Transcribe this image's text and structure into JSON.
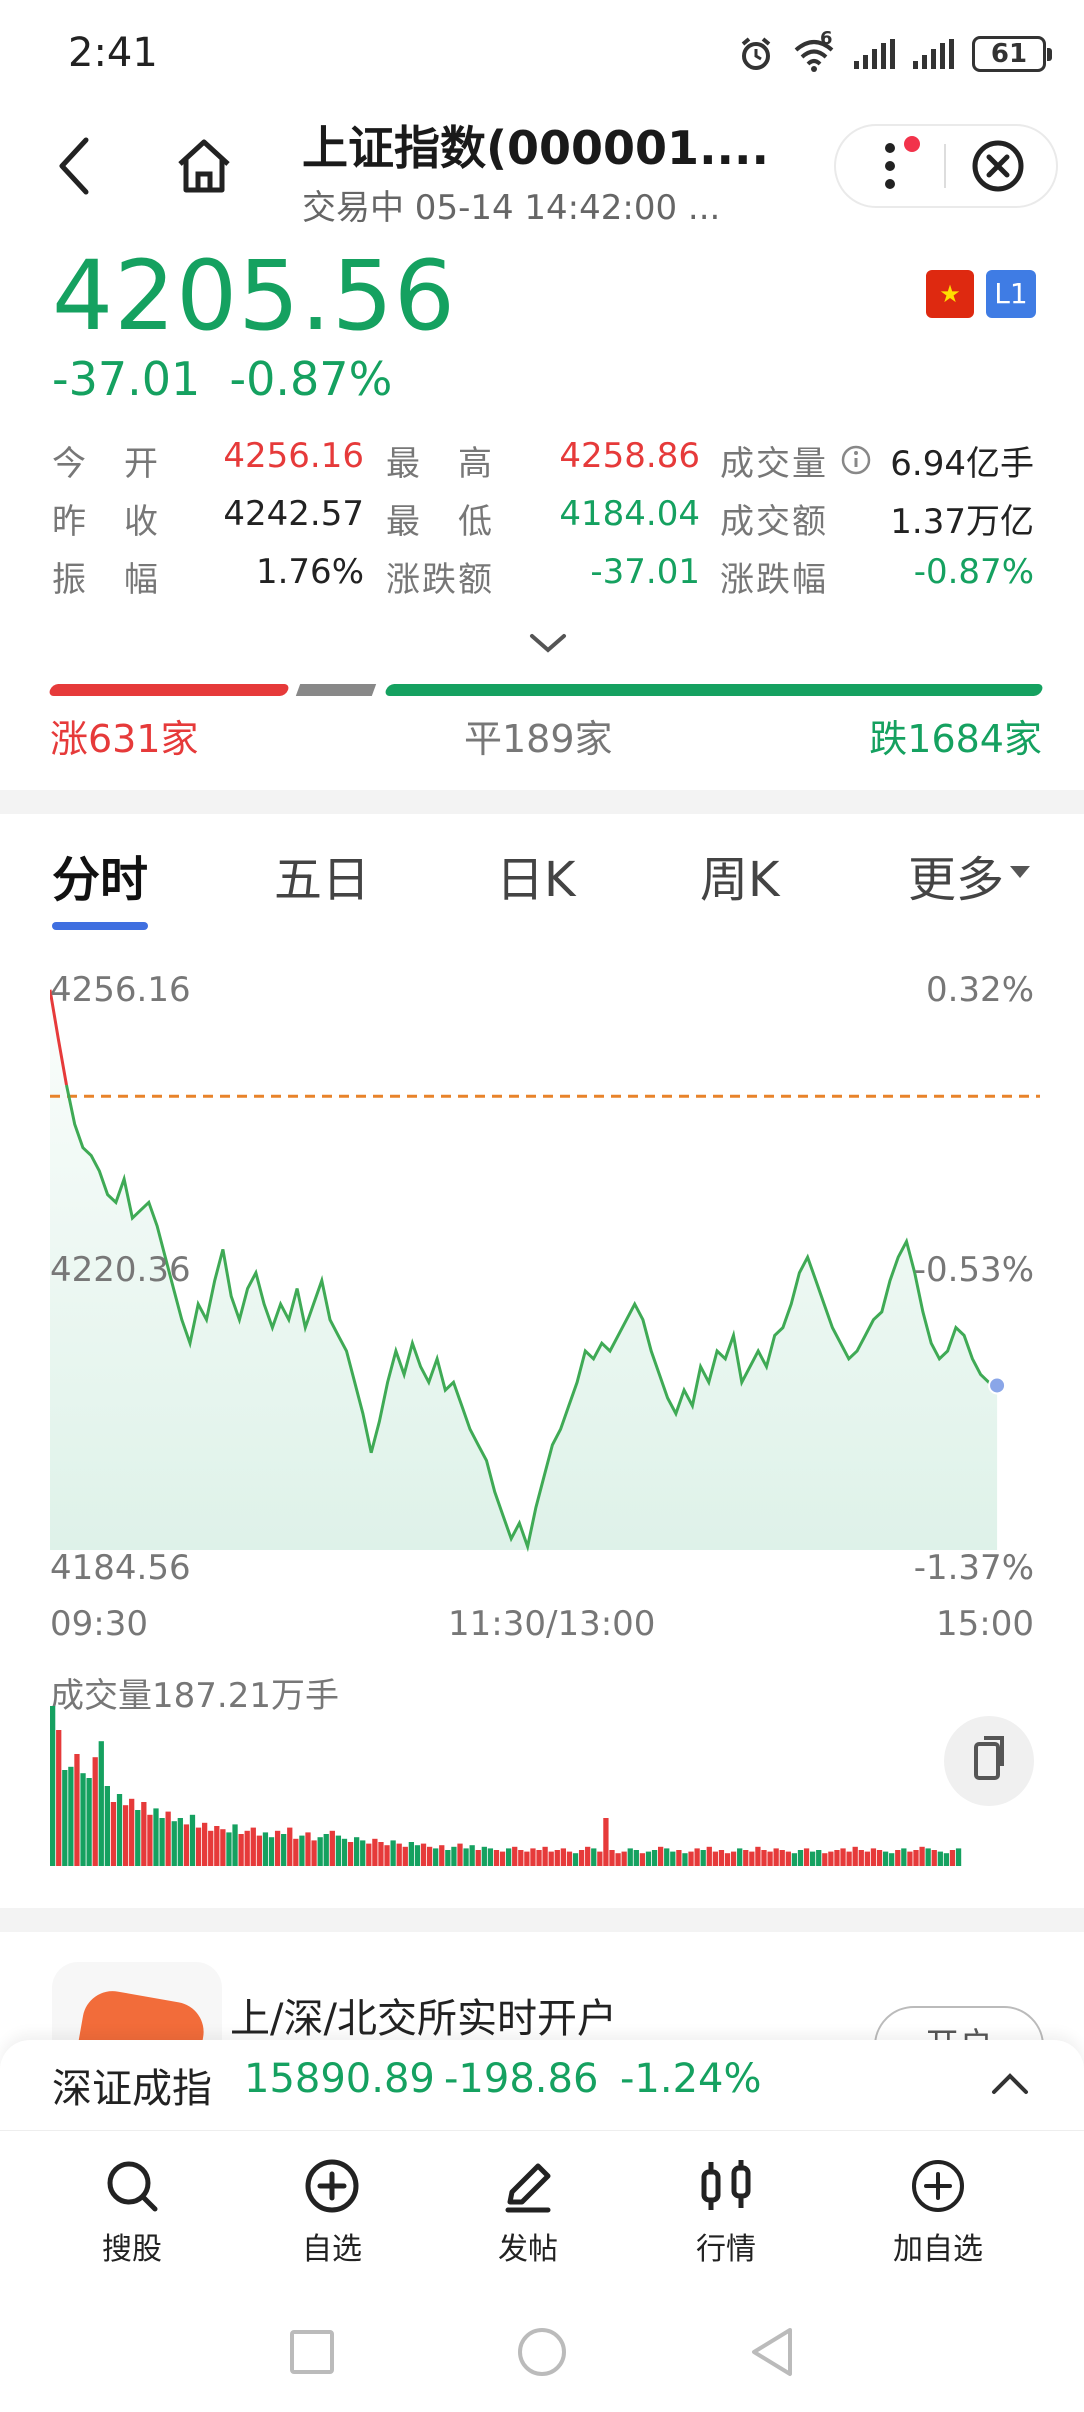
{
  "status_bar": {
    "time": "2:41",
    "battery": "61",
    "wifi_label": "6"
  },
  "header": {
    "title": "上证指数(000001....",
    "subtitle": "交易中 05-14 14:42:00 ..."
  },
  "quote": {
    "price": "4205.56",
    "change": "-37.01",
    "change_pct": "-0.87%",
    "level_badge": "L1",
    "flag_icon": "china-flag-icon"
  },
  "stats": [
    [
      {
        "label": "今　开",
        "value": "4256.16",
        "color": "#e63a3a"
      },
      {
        "label": "最　高",
        "value": "4258.86",
        "color": "#e63a3a"
      },
      {
        "label": "成交量",
        "value": "6.94亿手",
        "color": "#222222"
      }
    ],
    [
      {
        "label": "昨　收",
        "value": "4242.57",
        "color": "#222222"
      },
      {
        "label": "最　低",
        "value": "4184.04",
        "color": "#15a160"
      },
      {
        "label": "成交额",
        "value": "1.37万亿",
        "color": "#222222"
      }
    ],
    [
      {
        "label": "振　幅",
        "value": "1.76%",
        "color": "#222222"
      },
      {
        "label": "涨跌额",
        "value": "-37.01",
        "color": "#15a160"
      },
      {
        "label": "涨跌幅",
        "value": "-0.87%",
        "color": "#15a160"
      }
    ]
  ],
  "breadth": {
    "up": "涨631家",
    "flat": "平189家",
    "down": "跌1684家",
    "up_count": 631,
    "flat_count": 189,
    "down_count": 1684
  },
  "tabs": [
    "分时",
    "五日",
    "日K",
    "周K",
    "更多"
  ],
  "chart": {
    "y_top": "4256.16",
    "y_mid": "4220.36",
    "y_bottom": "4184.56",
    "pct_top": "0.32%",
    "pct_mid": "-0.53%",
    "pct_bottom": "-1.37%",
    "x_start": "09:30",
    "x_mid": "11:30/13:00",
    "x_end": "15:00",
    "volume_label": "成交量187.21万手"
  },
  "chart_data": {
    "type": "line",
    "prev_close": 4242.57,
    "ylim": [
      4184.56,
      4256.16
    ],
    "series": [
      {
        "values": [
          4256.2,
          4250,
          4244,
          4239,
          4236,
          4235,
          4233,
          4230,
          4229,
          4232,
          4227,
          4228,
          4229,
          4226,
          4222,
          4218,
          4214,
          4211,
          4216,
          4214,
          4219,
          4223,
          4217,
          4214,
          4218,
          4220,
          4216,
          4213,
          4216,
          4214,
          4218,
          4213,
          4216,
          4219,
          4214,
          4212,
          4210,
          4206,
          4202,
          4197,
          4201,
          4206,
          4210,
          4207,
          4211,
          4208,
          4206,
          4209,
          4205,
          4206,
          4203,
          4200,
          4198,
          4196,
          4192,
          4189,
          4186,
          4188,
          4185,
          4190,
          4194,
          4198,
          4200,
          4203,
          4206,
          4210,
          4209,
          4211,
          4210,
          4212,
          4214,
          4216,
          4214,
          4210,
          4207,
          4204,
          4202,
          4205,
          4203,
          4208,
          4206,
          4210,
          4209,
          4212,
          4206,
          4208,
          4210,
          4208,
          4212,
          4213,
          4216,
          4220,
          4222,
          4219,
          4216,
          4213,
          4211,
          4209,
          4210,
          4212,
          4214,
          4215,
          4219,
          4222,
          4224,
          4220,
          4215,
          4211,
          4209,
          4210,
          4213,
          4212,
          4209,
          4207,
          4206,
          4205.6
        ]
      }
    ]
  },
  "volume_data": {
    "values": [
      100,
      85,
      60,
      62,
      70,
      58,
      55,
      68,
      78,
      50,
      40,
      45,
      38,
      42,
      35,
      40,
      32,
      36,
      30,
      34,
      28,
      30,
      26,
      32,
      24,
      27,
      22,
      25,
      23,
      21,
      26,
      20,
      22,
      24,
      19,
      21,
      18,
      22,
      20,
      24,
      17,
      19,
      21,
      16,
      18,
      20,
      22,
      19,
      17,
      15,
      18,
      16,
      14,
      17,
      15,
      13,
      16,
      14,
      12,
      15,
      13,
      14,
      12,
      11,
      13,
      10,
      12,
      14,
      11,
      13,
      10,
      12,
      11,
      10,
      9,
      11,
      12,
      10,
      9,
      11,
      10,
      12,
      9,
      10,
      11,
      9,
      8,
      10,
      12,
      11,
      9,
      30,
      10,
      8,
      9,
      11,
      10,
      8,
      9,
      10,
      12,
      11,
      9,
      10,
      8,
      9,
      11,
      10,
      12,
      9,
      10,
      8,
      9,
      11,
      10,
      9,
      12,
      10,
      9,
      11,
      10,
      9,
      8,
      10,
      11,
      9,
      10,
      8,
      9,
      10,
      11,
      9,
      12,
      10,
      9,
      11,
      10,
      9,
      8,
      10,
      11,
      9,
      10,
      12,
      11,
      10,
      9,
      8,
      10,
      11
    ]
  },
  "promo": {
    "text": "上/深/北交所实时开户",
    "button": "开户"
  },
  "ticker": {
    "name": "深证成指",
    "price": "15890.89",
    "change": "-198.86",
    "pct": "-1.24%"
  },
  "nav": [
    {
      "label": "搜股",
      "icon": "search-icon"
    },
    {
      "label": "自选",
      "icon": "add-circle-icon"
    },
    {
      "label": "发帖",
      "icon": "pen-icon"
    },
    {
      "label": "行情",
      "icon": "candlestick-icon"
    },
    {
      "label": "加自选",
      "icon": "add-circle-icon"
    }
  ],
  "colors": {
    "up": "#e63a3a",
    "down": "#15a160",
    "accent": "#3f6fe0"
  }
}
